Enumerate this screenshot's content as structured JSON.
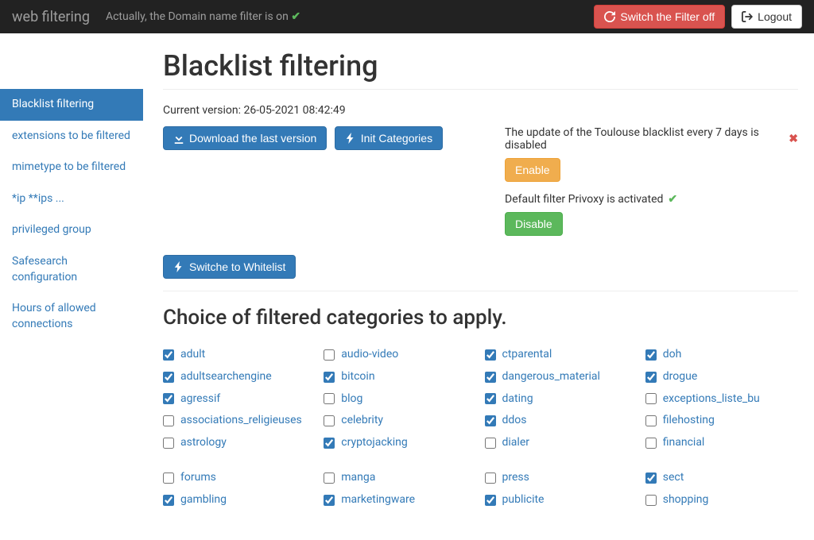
{
  "navbar": {
    "brand": "web filtering",
    "status_text": "Actually, the Domain name filter is on",
    "switch_btn": "Switch the Filter off",
    "logout_btn": "Logout"
  },
  "sidebar": {
    "items": [
      "Blacklist filtering",
      "extensions to be filtered",
      "mimetype to be filtered",
      "*ip **ips ...",
      "privileged group",
      "Safesearch configuration",
      "Hours of allowed connections"
    ]
  },
  "main": {
    "title": "Blacklist filtering",
    "version_label": "Current version:",
    "version_value": "26-05-2021 08:42:49",
    "download_btn": "Download the last version",
    "init_btn": "Init Categories",
    "switch_wl_btn": "Switche to Whitelist",
    "auto_update_text": "The update of the Toulouse blacklist every 7 days is disabled",
    "enable_btn": "Enable",
    "default_filter_text": "Default filter Privoxy is activated",
    "disable_btn": "Disable",
    "categories_heading": "Choice of filtered categories to apply."
  },
  "categories": [
    [
      [
        {
          "label": "adult",
          "checked": true
        },
        {
          "label": "adultsearchengine",
          "checked": true
        },
        {
          "label": "agressif",
          "checked": true
        },
        {
          "label": "associations_religieuses",
          "checked": false
        },
        {
          "label": "astrology",
          "checked": false
        }
      ],
      [
        {
          "label": "forums",
          "checked": false
        },
        {
          "label": "gambling",
          "checked": true
        }
      ]
    ],
    [
      [
        {
          "label": "audio-video",
          "checked": false
        },
        {
          "label": "bitcoin",
          "checked": true
        },
        {
          "label": "blog",
          "checked": false
        },
        {
          "label": "celebrity",
          "checked": false
        },
        {
          "label": "cryptojacking",
          "checked": true
        }
      ],
      [
        {
          "label": "manga",
          "checked": false
        },
        {
          "label": "marketingware",
          "checked": true
        }
      ]
    ],
    [
      [
        {
          "label": "ctparental",
          "checked": true
        },
        {
          "label": "dangerous_material",
          "checked": true
        },
        {
          "label": "dating",
          "checked": true
        },
        {
          "label": "ddos",
          "checked": true
        },
        {
          "label": "dialer",
          "checked": false
        }
      ],
      [
        {
          "label": "press",
          "checked": false
        },
        {
          "label": "publicite",
          "checked": true
        }
      ]
    ],
    [
      [
        {
          "label": "doh",
          "checked": true
        },
        {
          "label": "drogue",
          "checked": true
        },
        {
          "label": "exceptions_liste_bu",
          "checked": false
        },
        {
          "label": "filehosting",
          "checked": false
        },
        {
          "label": "financial",
          "checked": false
        }
      ],
      [
        {
          "label": "sect",
          "checked": true
        },
        {
          "label": "shopping",
          "checked": false
        }
      ]
    ]
  ]
}
